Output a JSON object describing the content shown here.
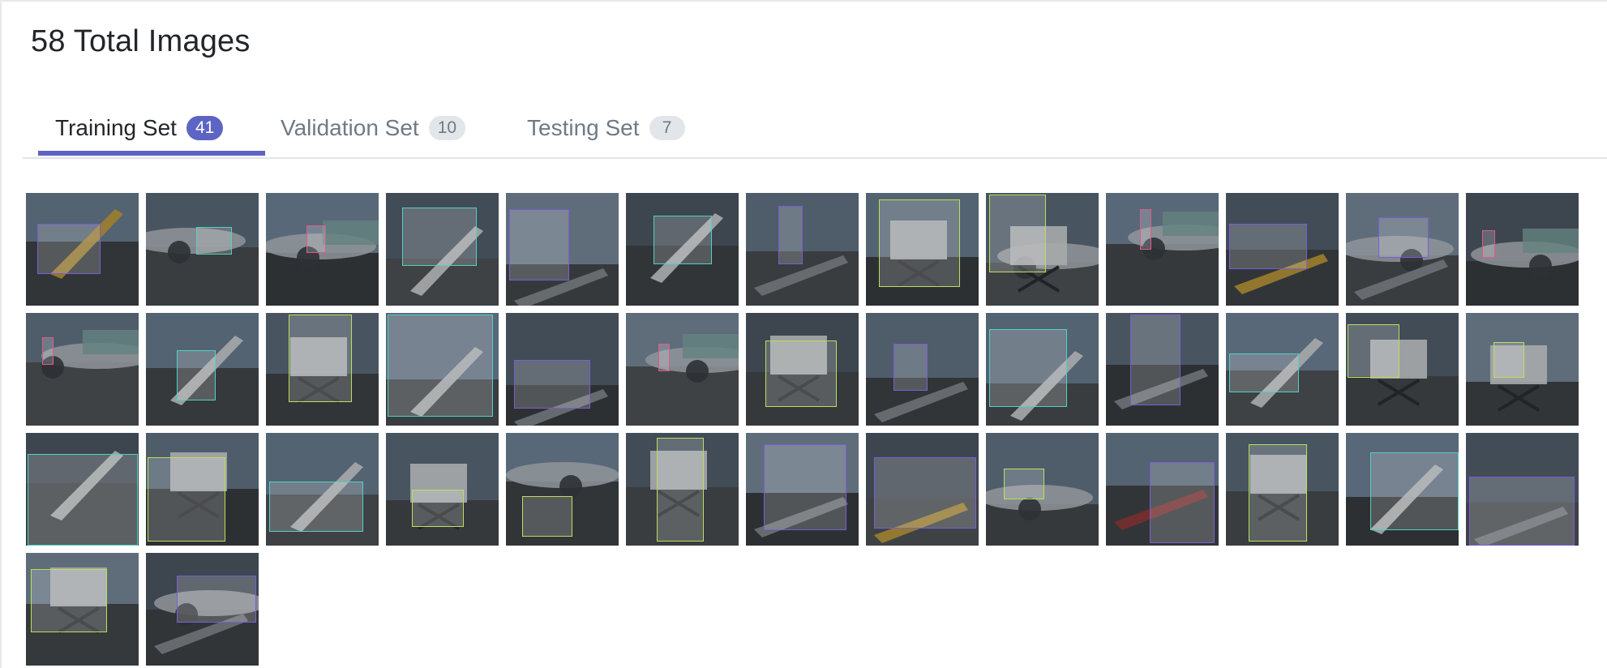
{
  "header": {
    "title": "58 Total Images"
  },
  "tabs": [
    {
      "label": "Training Set",
      "count": "41",
      "active": true
    },
    {
      "label": "Validation Set",
      "count": "10",
      "active": false
    },
    {
      "label": "Testing Set",
      "count": "7",
      "active": false
    }
  ],
  "colors": {
    "accent": "#5c64c4",
    "badge_inactive": "#e2e5e9",
    "text_inactive": "#6f7a86",
    "box_purple": "#7b5cd6",
    "box_green": "#b8e05a",
    "box_teal": "#4fd1c5",
    "box_pink": "#e05a8a"
  },
  "gallery": {
    "images": [
      {
        "theme": "yellow-stair-truck",
        "box": "purple"
      },
      {
        "theme": "jet-on-apron",
        "box": "teal"
      },
      {
        "theme": "jet-sky-bridge",
        "box": "pink"
      },
      {
        "theme": "boarding-stairs",
        "box": "teal"
      },
      {
        "theme": "baggage-loader",
        "box": "purple"
      },
      {
        "theme": "white-stairs",
        "box": "teal"
      },
      {
        "theme": "ground-crew",
        "box": "purple"
      },
      {
        "theme": "catering-truck",
        "box": "green"
      },
      {
        "theme": "engine-catering",
        "box": "green"
      },
      {
        "theme": "jet-bridge-night",
        "box": "pink"
      },
      {
        "theme": "yellow-belt-loader",
        "box": "purple"
      },
      {
        "theme": "engine-loader",
        "box": "purple"
      },
      {
        "theme": "jet-bridge",
        "box": "pink"
      },
      {
        "theme": "jet-bridge",
        "box": "pink"
      },
      {
        "theme": "hangar-stairs",
        "box": "teal"
      },
      {
        "theme": "catering-truck",
        "box": "green"
      },
      {
        "theme": "stairs-sky",
        "box": "teal"
      },
      {
        "theme": "belt-loader",
        "box": "purple"
      },
      {
        "theme": "jet-bridge-night",
        "box": "pink"
      },
      {
        "theme": "servair-truck",
        "box": "green"
      },
      {
        "theme": "ground-crew",
        "box": "purple"
      },
      {
        "theme": "stair-truck",
        "box": "teal"
      },
      {
        "theme": "baggage-loader",
        "box": "purple"
      },
      {
        "theme": "white-stairs",
        "box": "teal"
      },
      {
        "theme": "catering-truck",
        "box": "green"
      },
      {
        "theme": "catering-truck",
        "box": "green"
      },
      {
        "theme": "stair-passengers",
        "box": "teal"
      },
      {
        "theme": "catering-truck",
        "box": "green"
      },
      {
        "theme": "white-stairs",
        "box": "teal"
      },
      {
        "theme": "scissor-lift",
        "box": "green"
      },
      {
        "theme": "jet-nose",
        "box": "green"
      },
      {
        "theme": "catering-truck",
        "box": "green"
      },
      {
        "theme": "belt-loader-sky",
        "box": "purple"
      },
      {
        "theme": "yellow-belt-loader",
        "box": "purple"
      },
      {
        "theme": "jet-on-apron",
        "box": "green"
      },
      {
        "theme": "red-belt-loader",
        "box": "purple"
      },
      {
        "theme": "catering-truck",
        "box": "green"
      },
      {
        "theme": "white-stairs",
        "box": "teal"
      },
      {
        "theme": "baggage-cart",
        "box": "purple"
      },
      {
        "theme": "catering-truck",
        "box": "green"
      },
      {
        "theme": "engine-loader",
        "box": "purple"
      }
    ]
  }
}
